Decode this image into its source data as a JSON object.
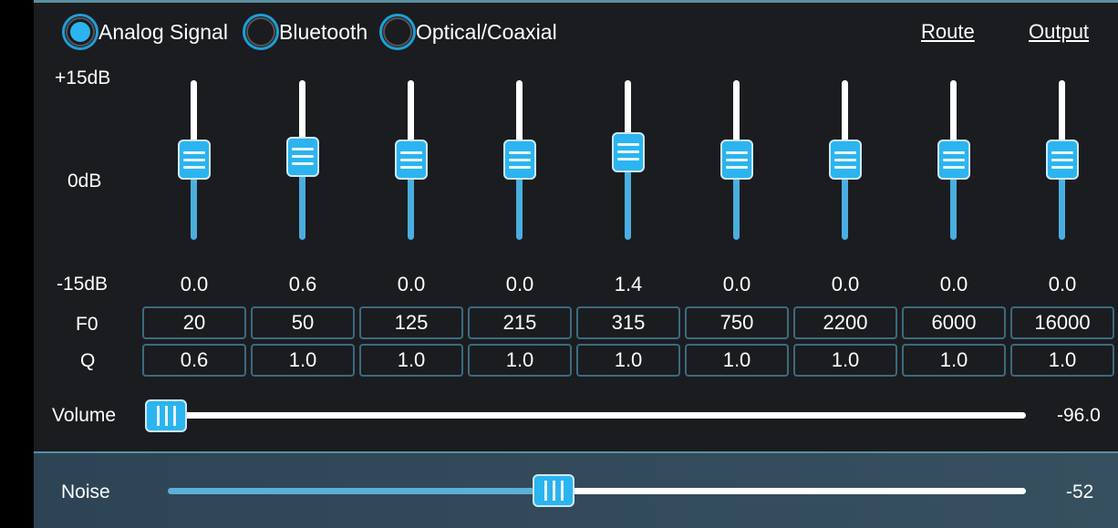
{
  "inputs": [
    {
      "label": "Analog Signal",
      "selected": true
    },
    {
      "label": "Bluetooth",
      "selected": false
    },
    {
      "label": "Optical/Coaxial",
      "selected": false
    }
  ],
  "links": {
    "route": "Route",
    "output": "Output"
  },
  "scale": {
    "top": "+15dB",
    "mid": "0dB",
    "bottom": "-15dB"
  },
  "row_labels": {
    "f0": "F0",
    "q": "Q"
  },
  "bands": [
    {
      "gain": "0.0",
      "f0": "20",
      "q": "0.6"
    },
    {
      "gain": "0.6",
      "f0": "50",
      "q": "1.0"
    },
    {
      "gain": "0.0",
      "f0": "125",
      "q": "1.0"
    },
    {
      "gain": "0.0",
      "f0": "215",
      "q": "1.0"
    },
    {
      "gain": "1.4",
      "f0": "315",
      "q": "1.0"
    },
    {
      "gain": "0.0",
      "f0": "750",
      "q": "1.0"
    },
    {
      "gain": "0.0",
      "f0": "2200",
      "q": "1.0"
    },
    {
      "gain": "0.0",
      "f0": "6000",
      "q": "1.0"
    },
    {
      "gain": "0.0",
      "f0": "16000",
      "q": "1.0"
    }
  ],
  "volume": {
    "label": "Volume",
    "value": "-96.0",
    "fraction": 0.0
  },
  "noise": {
    "label": "Noise",
    "value": "-52",
    "fraction": 0.45
  },
  "colors": {
    "accent": "#2bb4f0",
    "background": "#1b1c1f",
    "panel": "#2d4455"
  }
}
